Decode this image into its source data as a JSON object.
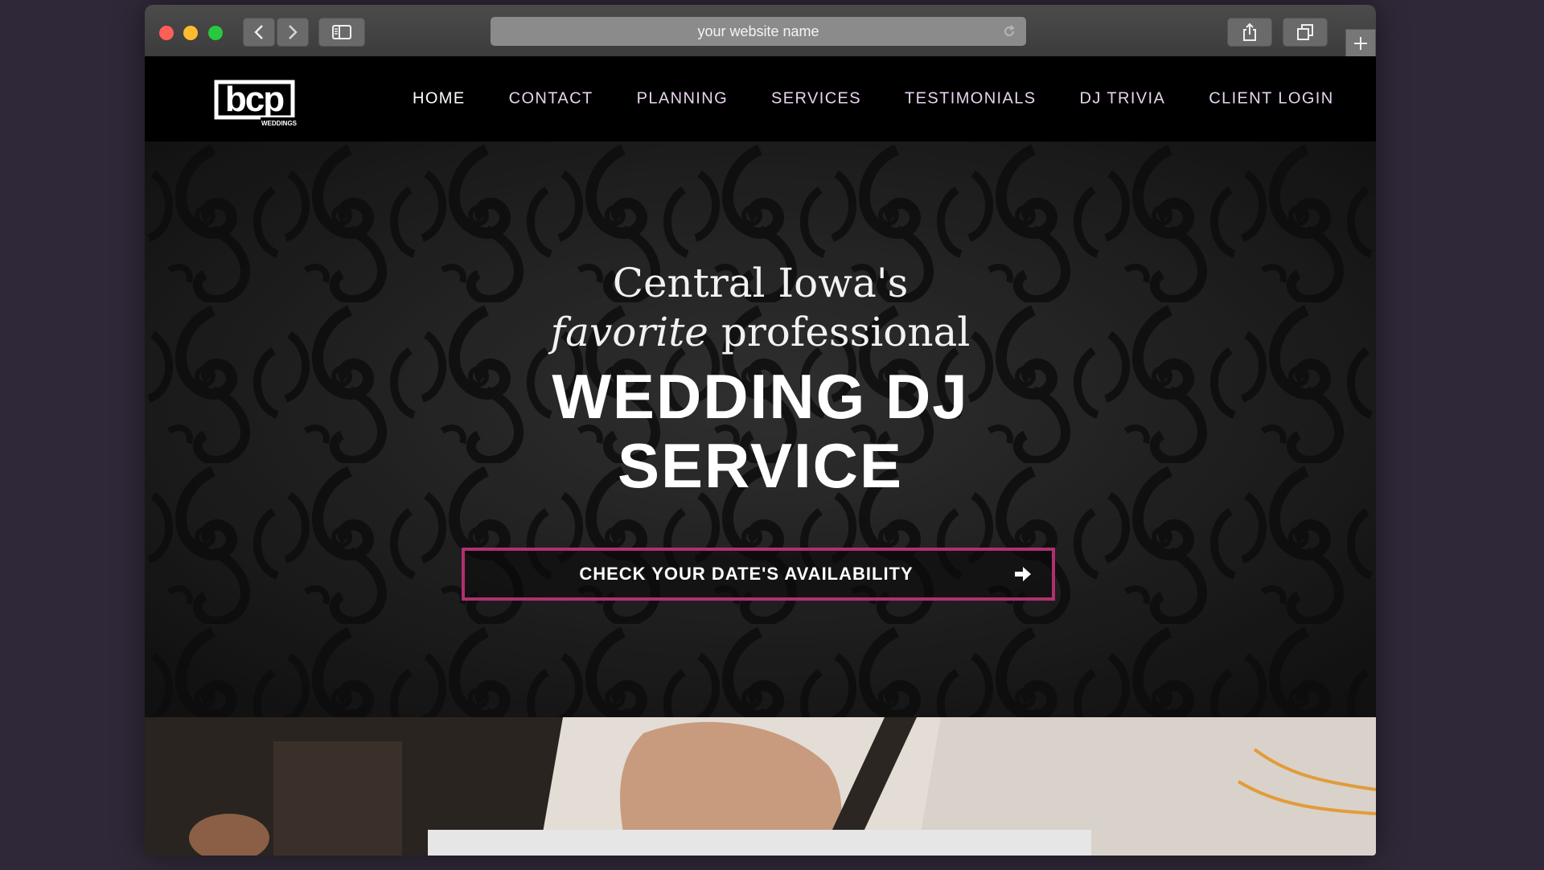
{
  "browser": {
    "address_text": "your website name",
    "icons": [
      "back-icon",
      "forward-icon",
      "sidebar-icon",
      "reload-icon",
      "share-icon",
      "tabs-icon",
      "new-tab-icon"
    ]
  },
  "site": {
    "logo_text": "bcp",
    "logo_subtext": "WEDDINGS",
    "nav": [
      "HOME",
      "CONTACT",
      "PLANNING",
      "SERVICES",
      "TESTIMONIALS",
      "DJ TRIVIA",
      "CLIENT LOGIN"
    ],
    "active_nav": "HOME"
  },
  "hero": {
    "line1": "Central Iowa's",
    "line2_italic": "favorite",
    "line2_rest": "professional",
    "line3": "WEDDING DJ",
    "line4": "SERVICE",
    "cta": "CHECK YOUR DATE'S AVAILABILITY"
  },
  "colors": {
    "accent": "#b0306f",
    "nav_text": "#e9d3ef",
    "background": "#2f2838"
  }
}
